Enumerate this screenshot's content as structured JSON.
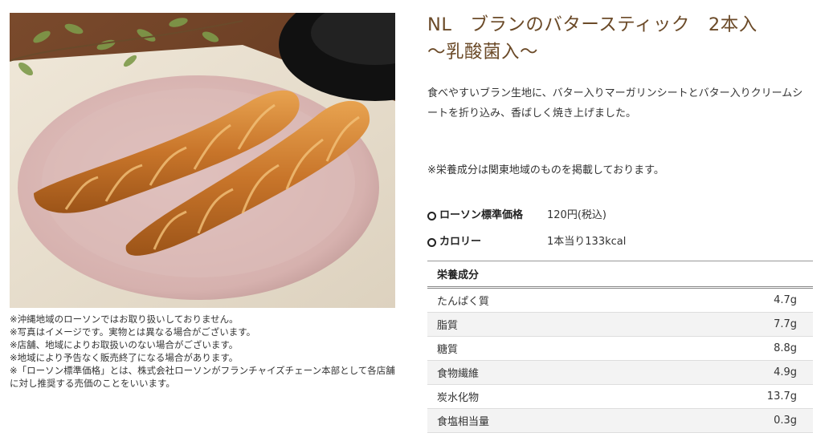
{
  "product": {
    "image_alt": "NL ブランのバタースティック 2本入 ～乳酸菌入～",
    "title": "NL　ブランのバタースティック　2本入　～乳酸菌入～",
    "description": "食べやすいブラン生地に、バター入りマーガリンシートとバター入りクリームシートを折り込み、香ばしく焼き上げました。",
    "region_note": "※栄養成分は関東地域のものを掲載しております。",
    "price_label": "ローソン標準価格",
    "price_value": "120円(税込)",
    "calorie_label": "カロリー",
    "calorie_value": "1本当り133kcal"
  },
  "notes": [
    "※沖縄地域のローソンではお取り扱いしておりません。",
    "※写真はイメージです。実物とは異なる場合がございます。",
    "※店舗、地域によりお取扱いのない場合がございます。",
    "※地域により予告なく販売終了になる場合があります。",
    "※「ローソン標準価格」とは、株式会社ローソンがフランチャイズチェーン本部として各店舗に対し推奨する売価のことをいいます。"
  ],
  "nutrition": {
    "header": "栄養成分",
    "rows": [
      {
        "name": "たんぱく質",
        "value": "4.7g"
      },
      {
        "name": "脂質",
        "value": "7.7g"
      },
      {
        "name": "糖質",
        "value": "8.8g"
      },
      {
        "name": "食物繊維",
        "value": "4.9g"
      },
      {
        "name": "炭水化物",
        "value": "13.7g"
      },
      {
        "name": "食塩相当量",
        "value": "0.3g"
      }
    ]
  },
  "colors": {
    "title": "#6b4a28",
    "plate": "#d9b7b5",
    "pastry": "#c87a2e"
  }
}
